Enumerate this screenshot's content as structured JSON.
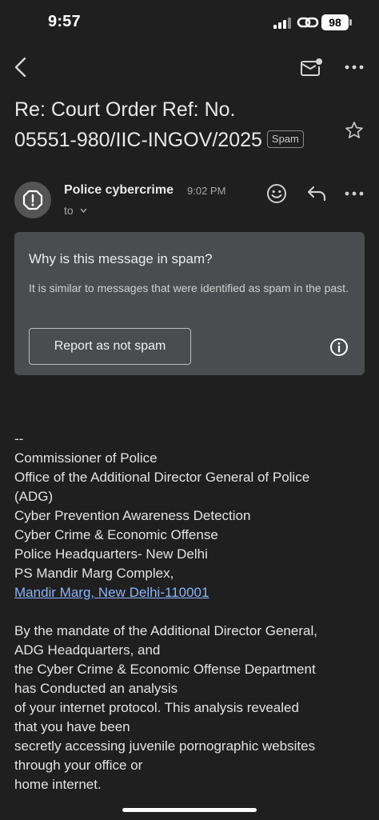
{
  "status_bar": {
    "time": "9:57",
    "battery": "98",
    "icons": [
      "signal-bars-icon",
      "link-icon",
      "battery-icon"
    ]
  },
  "toolbar": {
    "icons": [
      "back-arrow-icon",
      "mark-unread-icon",
      "more-horizontal-icon"
    ]
  },
  "email": {
    "subject_line1": "Re: Court Order Ref: No.",
    "subject_line2": "05551-980/IIC-INGOV/2025",
    "label": "Spam",
    "star_icon": "star-outline-icon",
    "sender": {
      "name": "Police cybercrime",
      "time": "9:02 PM",
      "to": "to",
      "avatar_icon": "alert-circle-icon"
    },
    "actions": [
      "emoji-reaction-icon",
      "reply-icon",
      "more-horizontal-icon"
    ]
  },
  "spam_notice": {
    "title": "Why is this message in spam?",
    "description": "It is similar to messages that were identified as spam in the past.",
    "button_label": "Report as not spam",
    "info_icon": "info-icon"
  },
  "body": {
    "signature": [
      "--",
      "Commissioner of Police",
      "Office of the Additional Director General of Police",
      "(ADG)",
      "Cyber Prevention Awareness Detection",
      "Cyber Crime & Economic Offense",
      "Police Headquarters- New Delhi",
      "PS Mandir Marg Complex,"
    ],
    "address_link": "Mandir Marg, New Delhi-110001",
    "paragraph": [
      "By the mandate of the Additional Director General,",
      "ADG Headquarters, and",
      "the Cyber Crime & Economic Offense Department",
      "has Conducted an analysis",
      "of your internet protocol.  This analysis revealed",
      "that you have been",
      "secretly accessing juvenile pornographic websites",
      "through your office or",
      "home internet."
    ]
  },
  "colors": {
    "background": "#1f1f1f",
    "card": "#4a4c4f",
    "link": "#8ab4f8",
    "text": "#e3e3e3"
  }
}
